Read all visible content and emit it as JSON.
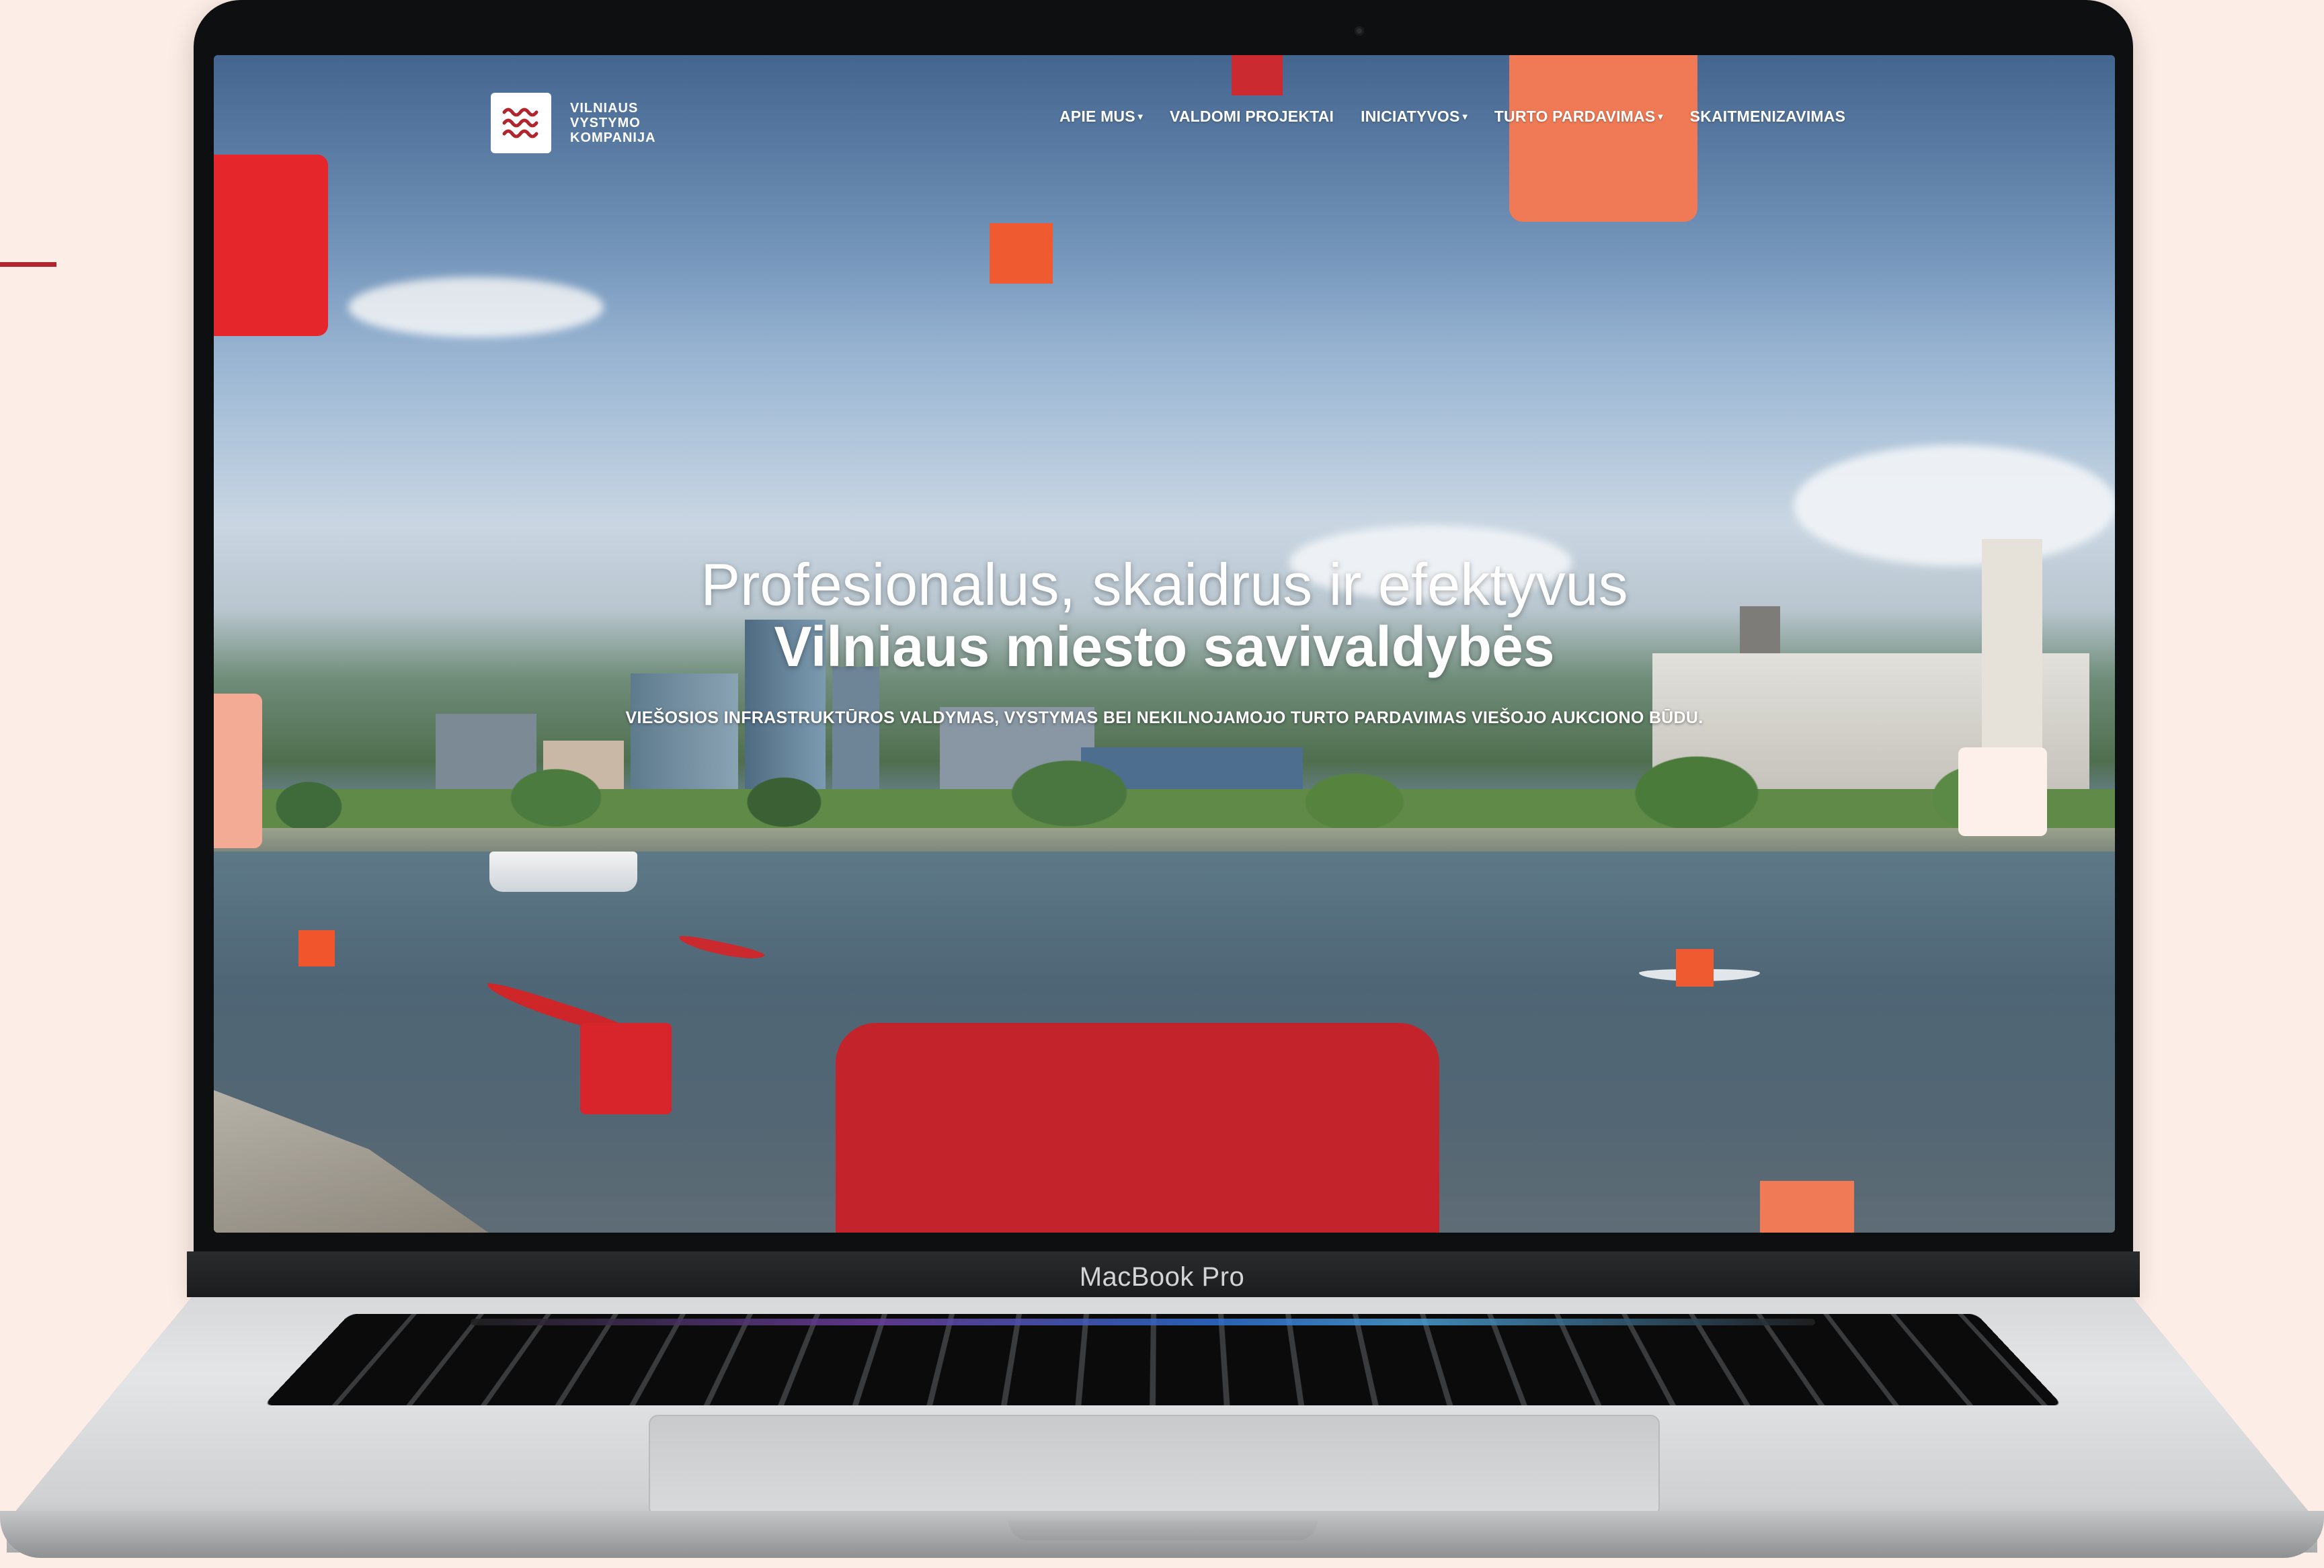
{
  "device": {
    "label": "MacBook Pro"
  },
  "site": {
    "logo": {
      "icon": "waves-logo-icon",
      "lines": [
        "VILNIAUS",
        "VYSTYMO",
        "KOMPANIJA"
      ]
    },
    "nav": [
      {
        "label": "APIE MUS",
        "has_dropdown": true
      },
      {
        "label": "VALDOMI PROJEKTAI",
        "has_dropdown": false
      },
      {
        "label": "INICIATYVOS",
        "has_dropdown": true
      },
      {
        "label": "TURTO PARDAVIMAS",
        "has_dropdown": true
      },
      {
        "label": "SKAITMENIZAVIMAS",
        "has_dropdown": false
      }
    ],
    "hero": {
      "line1": "Profesionalus, skaidrus ir efektyvus",
      "line2": "Vilniaus miesto savivaldybės",
      "subtitle": "VIEŠOSIOS INFRASTRUKTŪROS VALDYMAS, VYSTYMAS BEI NEKILNOJAMOJO TURTO PARDAVIMAS VIEŠOJO AUKCIONO BŪDU."
    }
  },
  "colors": {
    "page_background": "#fcede6",
    "brand_red": "#c3242c",
    "accent_red": "#e5262b",
    "accent_orange": "#f07a55",
    "accent_pink": "#f4ab95"
  }
}
